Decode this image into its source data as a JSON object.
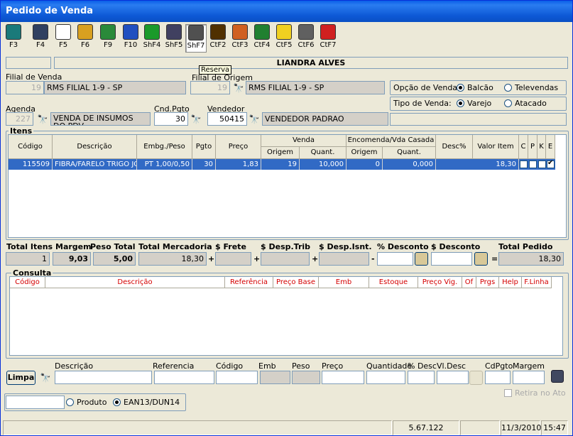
{
  "window": {
    "title": "Pedido de Venda"
  },
  "toolbar": [
    {
      "label": "F3",
      "icon": "door-exit-icon",
      "color": "#1a7a7a"
    },
    {
      "label": "F4",
      "icon": "floppy-disk-icon",
      "color": "#304060"
    },
    {
      "label": "F5",
      "icon": "document-list-icon",
      "color": "#ffffff"
    },
    {
      "label": "F6",
      "icon": "stacked-boxes-icon",
      "color": "#d8a020"
    },
    {
      "label": "F9",
      "icon": "recycle-bin-icon",
      "color": "#2a8a3a"
    },
    {
      "label": "F10",
      "icon": "puzzle-icon",
      "color": "#2050c0"
    },
    {
      "label": "ShF4",
      "icon": "green-check-doc-icon",
      "color": "#1a9a2a"
    },
    {
      "label": "ShF5",
      "icon": "bar-chart-icon",
      "color": "#404060"
    },
    {
      "label": "ShF7",
      "icon": "gear-icon",
      "color": "#505050"
    },
    {
      "label": "CtF2",
      "icon": "toolbox-icon",
      "color": "#503000"
    },
    {
      "label": "CtF3",
      "icon": "palette-icon",
      "color": "#d06020"
    },
    {
      "label": "CtF4",
      "icon": "chart-line-icon",
      "color": "#208030"
    },
    {
      "label": "CtF5",
      "icon": "lightbulb-icon",
      "color": "#f0d020"
    },
    {
      "label": "CtF6",
      "icon": "trash-can-icon",
      "color": "#606060"
    },
    {
      "label": "CtF7",
      "icon": "telephone-icon",
      "color": "#d02020"
    }
  ],
  "tooltip": "Reserva",
  "client_name": "LIANDRA ALVES",
  "filial_venda": {
    "label": "Filial de Venda",
    "code": "19",
    "name": "RMS FILIAL 1-9 - SP"
  },
  "filial_origem": {
    "label": "Filial de Origem",
    "code": "19",
    "name": "RMS FILIAL 1-9 - SP"
  },
  "opcao_venda": {
    "label": "Opção de Venda:",
    "options": [
      "Balcão",
      "Televendas"
    ],
    "selected": "Balcão"
  },
  "tipo_venda": {
    "label": "Tipo de Venda:",
    "options": [
      "Varejo",
      "Atacado"
    ],
    "selected": "Varejo"
  },
  "agenda": {
    "label": "Agenda",
    "code": "227",
    "desc": "VENDA DE INSUMOS DO PDV"
  },
  "cnd_pgto": {
    "label": "Cnd.Pgto",
    "value": "30"
  },
  "vendedor": {
    "label": "Vendedor",
    "code": "50415",
    "name": "VENDEDOR PADRAO"
  },
  "itens": {
    "title": "Itens",
    "headers": {
      "codigo": "Código",
      "descricao": "Descrição",
      "embg": "Embg./Peso",
      "pgto": "Pgto",
      "preco": "Preço",
      "venda": "Venda",
      "origem": "Origem",
      "quant": "Quant.",
      "encomenda": "Encomenda/Vda Casada",
      "enc_origem": "Origem",
      "enc_quant": "Quant.",
      "desc_pct": "Desc%",
      "valor": "Valor Item",
      "c": "C",
      "p": "P",
      "k": "K",
      "e": "E"
    },
    "rows": [
      {
        "codigo": "115509",
        "descricao": "FIBRA/FARELO TRIGO JO",
        "embg": "PT 1,00/0,50",
        "pgto": "30",
        "preco": "1,83",
        "origem": "19",
        "quant": "10,000",
        "enc_origem": "0",
        "enc_quant": "0,000",
        "desc_pct": "",
        "valor": "18,30",
        "c": false,
        "p": false,
        "k": false,
        "e": true
      }
    ]
  },
  "totals": {
    "total_itens": {
      "label": "Total Itens",
      "value": "1"
    },
    "margem": {
      "label": "Margem",
      "value": "9,03"
    },
    "peso_total": {
      "label": "Peso Total",
      "value": "5,00"
    },
    "total_mercadoria": {
      "label": "Total Mercadoria",
      "value": "18,30"
    },
    "frete": {
      "label": "$ Frete",
      "value": ""
    },
    "desp_trib": {
      "label": "$ Desp.Trib",
      "value": ""
    },
    "desp_isnt": {
      "label": "$ Desp.Isnt.",
      "value": ""
    },
    "pct_desconto": {
      "label": "% Desconto",
      "value": ""
    },
    "val_desconto": {
      "label": "$ Desconto",
      "value": ""
    },
    "total_pedido": {
      "label": "Total Pedido",
      "value": "18,30"
    },
    "ops": {
      "plus": "+",
      "minus": "-",
      "eq": "="
    }
  },
  "consulta": {
    "title": "Consulta",
    "headers": [
      "Código",
      "Descrição",
      "Referência",
      "Preço Base",
      "Emb",
      "Estoque",
      "Preço Vig.",
      "Of",
      "Prgs",
      "Help",
      "F.Linha"
    ]
  },
  "search": {
    "limpa": "Limpa",
    "labels": {
      "descricao": "Descrição",
      "referencia": "Referencia",
      "codigo": "Código",
      "emb": "Emb",
      "peso": "Peso",
      "preco": "Preço",
      "quantidade": "Quantidade",
      "pct_desc": "% Desc",
      "vl_desc": "Vl.Desc",
      "cdpgto": "CdPgto",
      "margem": "Margem"
    },
    "retira_no_ato": "Retira no Ato",
    "produto": "Produto",
    "ean": "EAN13/DUN14",
    "mode_selected": "EAN13/DUN14"
  },
  "statusbar": {
    "version": "5.67.122",
    "date": "11/3/2010",
    "time": "15:47"
  }
}
